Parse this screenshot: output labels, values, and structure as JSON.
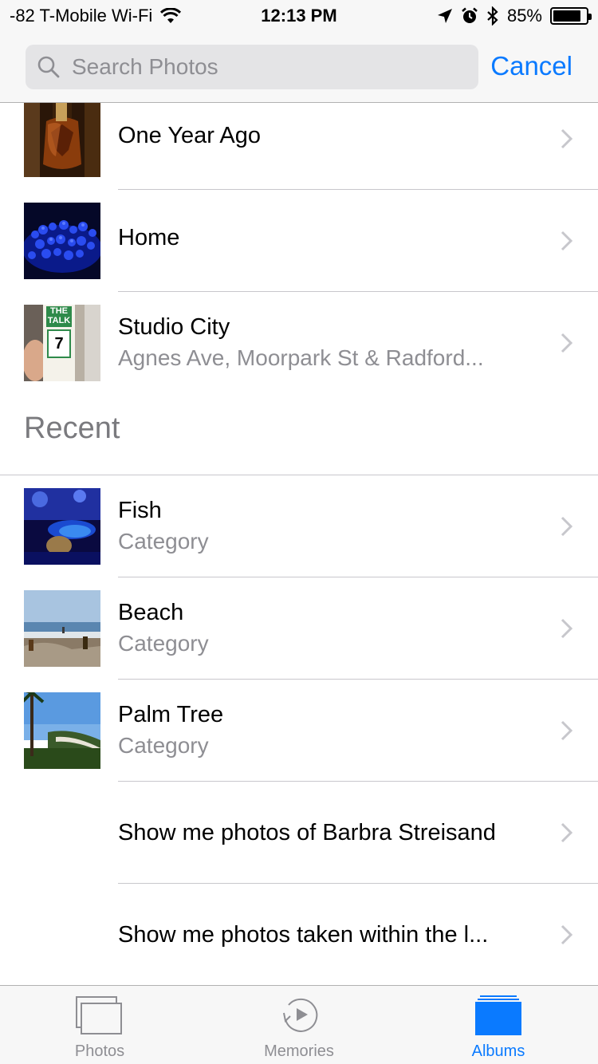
{
  "status_bar": {
    "carrier": "-82 T-Mobile Wi-Fi",
    "time": "12:13 PM",
    "battery_percent": "85%",
    "battery_level": 0.85
  },
  "search": {
    "placeholder": "Search Photos",
    "value": "",
    "cancel_label": "Cancel"
  },
  "results": [
    {
      "title": "One Year Ago",
      "subtitle": "",
      "thumb": "cognac-bottle"
    },
    {
      "title": "Home",
      "subtitle": "",
      "thumb": "blue-coral"
    },
    {
      "title": "Studio City",
      "subtitle": "Agnes Ave, Moorpark St & Radford...",
      "thumb": "the-talk-ticket"
    }
  ],
  "recent": {
    "header": "Recent",
    "items": [
      {
        "title": "Fish",
        "subtitle": "Category",
        "thumb": "fish-tank"
      },
      {
        "title": "Beach",
        "subtitle": "Category",
        "thumb": "beach"
      },
      {
        "title": "Palm Tree",
        "subtitle": "Category",
        "thumb": "palm-coast"
      },
      {
        "title": "Show me photos of Barbra Streisand",
        "subtitle": ""
      },
      {
        "title": "Show me photos taken within the l...",
        "subtitle": ""
      }
    ]
  },
  "ticket_text": {
    "line1": "THE",
    "line2": "TALK",
    "number": "7"
  },
  "tabs": [
    {
      "label": "Photos",
      "icon": "photos-icon",
      "active": false
    },
    {
      "label": "Memories",
      "icon": "memories-icon",
      "active": false
    },
    {
      "label": "Albums",
      "icon": "albums-icon",
      "active": true
    }
  ],
  "colors": {
    "accent": "#0a7aff",
    "secondary_text": "#8e8e93"
  }
}
